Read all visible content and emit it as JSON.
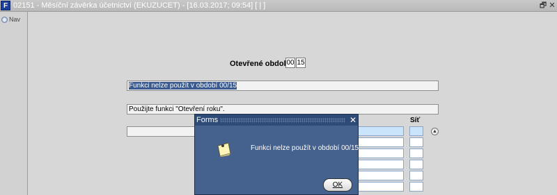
{
  "window": {
    "app_icon_glyph": "F",
    "title": "02151 - Měsíční závěrka účetnictví (EKUZUCET) - [16.03.2017; 09:54]  [ | ]",
    "restore_glyph": "🗗",
    "close_glyph": "✕"
  },
  "sidebar": {
    "nav_label": "Nav"
  },
  "form": {
    "period_label": "Otevřené období",
    "period_month": "00",
    "period_year": "15",
    "message_field": "Funkci nelze použít v období 00/15",
    "hint_field": "Použijte funkci \"Otevření roku\".",
    "column_sit": "Síť"
  },
  "dialog": {
    "title": "Forms",
    "close_glyph": "✕",
    "message": "Funkci nelze použít v období 00/15",
    "ok_label": "OK",
    "icon": "note-icon"
  }
}
